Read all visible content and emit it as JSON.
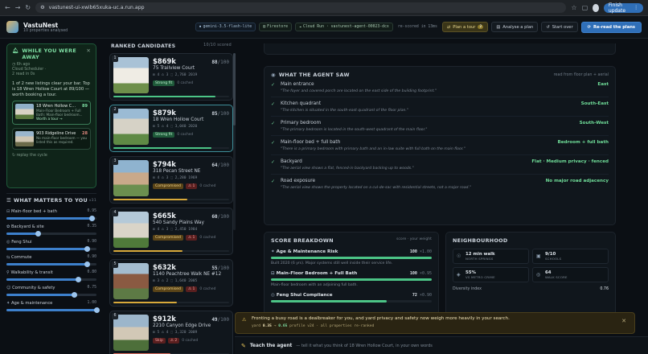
{
  "browser": {
    "url": "vastunest-ui-xwib65xuka-uc.a.run.app",
    "finish_update": "Finish update"
  },
  "app": {
    "name": "VastuNest",
    "subtitle": "10 properties analysed",
    "chips": [
      "gemini-3.5-flash-lite",
      "Firestore",
      "Cloud Run · vastunest-agent-00023-dcx"
    ],
    "rescored": "re-scored in 13ms",
    "plan_tour": "Plan a tour",
    "plan_tour_count": "2",
    "analyse": "Analyse a plan",
    "start_over": "Start over",
    "reread": "Re-read the plans"
  },
  "alert": {
    "title": "WHILE YOU WERE AWAY",
    "meta1": "6h ago",
    "meta2": "Cloud Scheduler ·",
    "meta3": "2 read in 0s",
    "body": "1 of 2 new listings clear your bar. Top is 18 Wren Hollow Court at 89/100 — worth booking a tour.",
    "items": [
      {
        "name": "18 Wren Hollow C...",
        "score": "89",
        "desc": "Main-Floor Bedroom + Full Bath: Main-floor bedroom...",
        "action": "Worth a tour →"
      },
      {
        "name": "903 Ridgeline Drive",
        "score": "28",
        "desc": "No main-floor bedroom — you listed this as required.",
        "action": ""
      }
    ],
    "replay": "↻ replay the cycle"
  },
  "matters": {
    "title": "WHAT MATTERS TO YOU",
    "sub": "v31",
    "items": [
      {
        "label": "Main-floor bed + bath",
        "value": "0.95",
        "level": 0.95
      },
      {
        "label": "Backyard & site",
        "value": "0.35",
        "level": 0.35
      },
      {
        "label": "Feng Shui",
        "value": "0.90",
        "level": 0.9
      },
      {
        "label": "Commute",
        "value": "0.90",
        "level": 0.9
      },
      {
        "label": "Walkability & transit",
        "value": "0.80",
        "level": 0.8
      },
      {
        "label": "Community & safety",
        "value": "0.75",
        "level": 0.75
      },
      {
        "label": "Age & maintenance",
        "value": "1.00",
        "level": 1.0
      }
    ]
  },
  "candidates": {
    "title": "RANKED CANDIDATES",
    "count": "10/10 scored",
    "items": [
      {
        "rank": "1",
        "price": "$869k",
        "score": "88",
        "of": "/100",
        "addr": "75 Trailview Court",
        "specs": "⊟ 4  ⌂ 3  ⬚ 2,760  2019",
        "tag": "Strong fit",
        "tagtype": "strong",
        "flag": "",
        "cached": "0 cached",
        "fit": 0.88
      },
      {
        "rank": "2",
        "price": "$879k",
        "score": "85",
        "of": "/100",
        "addr": "18 Wren Hollow Court",
        "specs": "⊟ 5  ⌂ 4  ⬚ 3,040  2020",
        "tag": "Strong fit",
        "tagtype": "strong",
        "flag": "",
        "cached": "0 cached",
        "fit": 0.85
      },
      {
        "rank": "3",
        "price": "$794k",
        "score": "64",
        "of": "/100",
        "addr": "318 Pecan Street NE",
        "specs": "⊟ 4  ⌂ 3  ⬚ 2,280  1969",
        "tag": "Compromised",
        "tagtype": "comp",
        "flag": "⚠ 1",
        "cached": "0 cached",
        "fit": 0.64
      },
      {
        "rank": "4",
        "price": "$665k",
        "score": "60",
        "of": "/100",
        "addr": "540 Sandy Plains Way",
        "specs": "⊟ 4  ⌂ 3  ⬚ 2,450  1984",
        "tag": "Compromised",
        "tagtype": "comp",
        "flag": "⚠ 1",
        "cached": "0 cached",
        "fit": 0.6
      },
      {
        "rank": "5",
        "price": "$632k",
        "score": "55",
        "of": "/100",
        "addr": "1140 Peachtree Walk NE #12",
        "specs": "⊟ 3  ⌂ 2  ⬚ 1,640  2005",
        "tag": "Compromised",
        "tagtype": "comp",
        "flag": "⚠ 1",
        "cached": "0 cached",
        "fit": 0.55
      },
      {
        "rank": "6",
        "price": "$912k",
        "score": "49",
        "of": "/100",
        "addr": "2210 Canyon Edge Drive",
        "specs": "⊟ 5  ⌂ 4  ⬚ 3,320  2009",
        "tag": "Skip",
        "tagtype": "flag",
        "flag": "⚠ 2",
        "cached": "0 cached",
        "fit": 0.49
      }
    ]
  },
  "saw": {
    "title": "WHAT THE AGENT SAW",
    "sub": "read from floor plan + aerial",
    "items": [
      {
        "label": "Main entrance",
        "value": "East",
        "quote": "\"The foyer and covered porch are located on the east side of the building footprint.\""
      },
      {
        "label": "Kitchen quadrant",
        "value": "South-East",
        "quote": "\"The kitchen is situated in the south-east quadrant of the floor plan.\""
      },
      {
        "label": "Primary bedroom",
        "value": "South-West",
        "quote": "\"The primary bedroom is located in the south-west quadrant of the main floor.\""
      },
      {
        "label": "Main-floor bed + full bath",
        "value": "Bedroom + full bath",
        "quote": "\"There is a primary bedroom with primary bath and an in-law suite with full bath on the main floor.\""
      },
      {
        "label": "Backyard",
        "value": "Flat · Medium privacy · fenced",
        "quote": "\"The aerial view shows a flat, fenced-in backyard backing up to woods.\""
      },
      {
        "label": "Road exposure",
        "value": "No major road adjacency",
        "quote": "\"The aerial view shows the property located on a cul-de-sac with residential streets, not a major road.\""
      }
    ]
  },
  "breakdown": {
    "title": "SCORE BREAKDOWN",
    "sub": "score · your weight",
    "items": [
      {
        "label": "Age & Maintenance Risk",
        "score": "100",
        "weight": "×1.00",
        "level": 1.0,
        "desc": "Built 2020 (6 yrs). Major systems still well inside their service life."
      },
      {
        "label": "Main-Floor Bedroom + Full Bath",
        "score": "100",
        "weight": "×0.95",
        "level": 1.0,
        "desc": "Main-floor bedroom with an adjoining full bath."
      },
      {
        "label": "Feng Shui Compliance",
        "score": "72",
        "weight": "×0.90",
        "level": 0.72,
        "desc": ""
      }
    ]
  },
  "hood": {
    "title": "NEIGHBOURHOOD",
    "stats": [
      {
        "icon": "☉",
        "value": "12 min walk",
        "label": "NORTH SPRINGS"
      },
      {
        "icon": "▣",
        "value": "9/10",
        "label": "SCHOOLS"
      },
      {
        "icon": "◈",
        "value": "55%",
        "label": "VS METRO CRIME"
      },
      {
        "icon": "◎",
        "value": "64",
        "label": "WALK SCORE"
      }
    ],
    "diversity_label": "Diversity index",
    "diversity_value": "0.76"
  },
  "toast": {
    "message": "Fronting a busy road is a dealbreaker for you, and yard privacy and safety now weigh more heavily in your search.",
    "meta_prefix": "yard",
    "meta_from": "0.35",
    "meta_arrow": "→",
    "meta_to": "0.65",
    "meta_suffix": "profile v24 · all properties re-ranked"
  },
  "teach": {
    "label": "Teach the agent",
    "hint": "— tell it what you think of 18 Wren Hollow Court, in your own words"
  }
}
